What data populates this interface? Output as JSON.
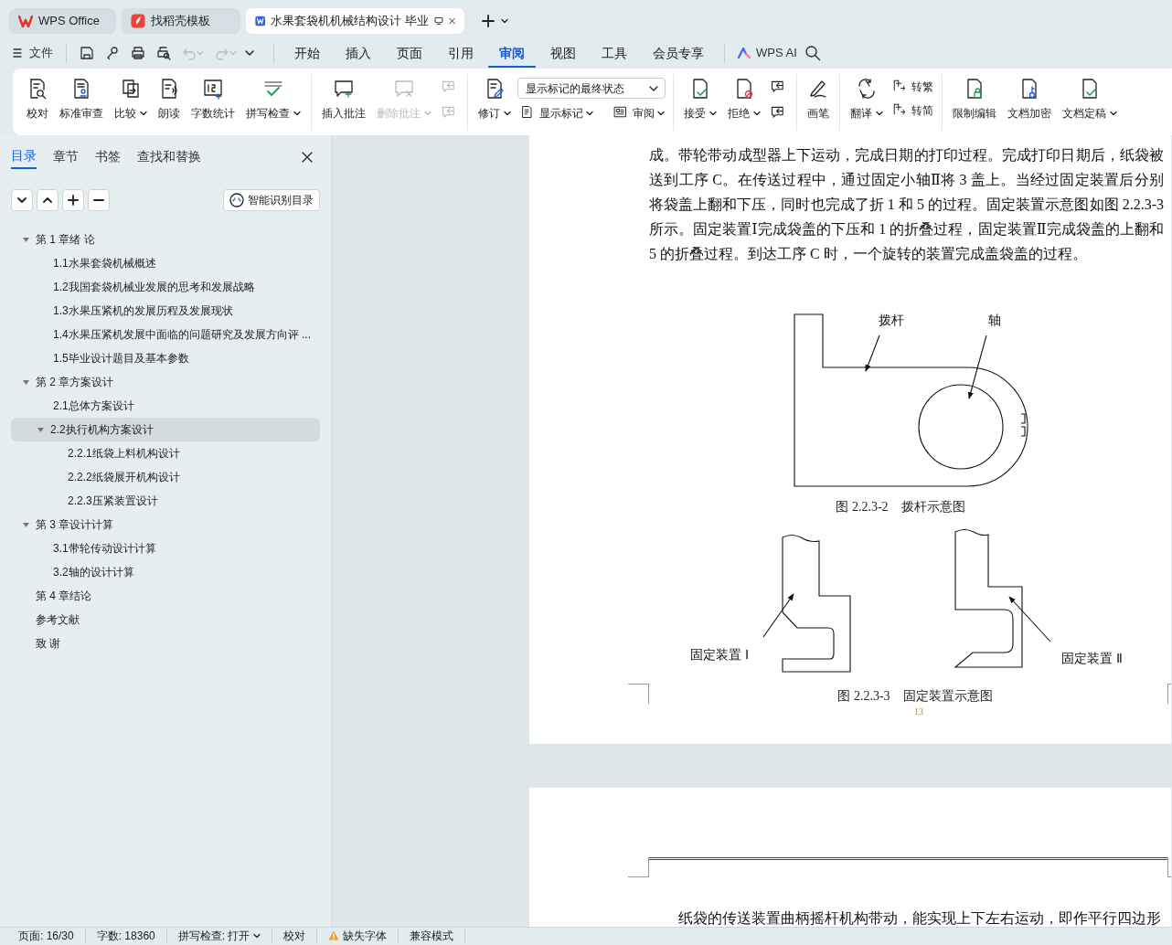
{
  "tabs": [
    {
      "label": "WPS Office",
      "kind": "home",
      "selected": false
    },
    {
      "label": "找稻壳模板",
      "kind": "template",
      "selected": false
    },
    {
      "label": "水果套袋机机械结构设计 毕业",
      "kind": "document",
      "selected": true
    }
  ],
  "menu": {
    "file": "文件",
    "tabs": [
      {
        "label": "开始",
        "selected": false
      },
      {
        "label": "插入",
        "selected": false
      },
      {
        "label": "页面",
        "selected": false
      },
      {
        "label": "引用",
        "selected": false
      },
      {
        "label": "审阅",
        "selected": true
      },
      {
        "label": "视图",
        "selected": false
      },
      {
        "label": "工具",
        "selected": false
      },
      {
        "label": "会员专享",
        "selected": false
      }
    ],
    "ai": "WPS AI"
  },
  "ribbon": [
    {
      "items": [
        {
          "kind": "large",
          "label": "校对",
          "dropdown": false,
          "disabled": false
        },
        {
          "kind": "large",
          "label": "标准审查",
          "dropdown": false,
          "disabled": false
        },
        {
          "kind": "large",
          "label": "比较",
          "dropdown": true,
          "disabled": false
        },
        {
          "kind": "large",
          "label": "朗读",
          "dropdown": false,
          "disabled": false
        },
        {
          "kind": "large",
          "label": "字数统计",
          "dropdown": false,
          "disabled": false
        },
        {
          "kind": "large",
          "label": "拼写检查",
          "dropdown": true,
          "disabled": false
        }
      ]
    },
    {
      "items": [
        {
          "kind": "large",
          "label": "插入批注",
          "dropdown": false,
          "disabled": false
        },
        {
          "kind": "large",
          "label": "删除批注",
          "dropdown": true,
          "disabled": true
        },
        {
          "kind": "column",
          "rows": [
            [
              {
                "kind": "small",
                "dropdown": false,
                "disabled": true
              }
            ],
            [
              {
                "kind": "small",
                "dropdown": false,
                "disabled": true
              }
            ]
          ]
        }
      ]
    },
    {
      "items": [
        {
          "kind": "large",
          "label": "修订",
          "dropdown": true,
          "disabled": false
        },
        {
          "kind": "column",
          "rows": [
            [
              {
                "kind": "select",
                "value": "显示标记的最终状态"
              }
            ],
            [
              {
                "kind": "small",
                "label": "显示标记",
                "dropdown": true,
                "disabled": false
              },
              {
                "kind": "small",
                "label": "审阅",
                "dropdown": true,
                "disabled": false
              }
            ]
          ]
        }
      ]
    },
    {
      "items": [
        {
          "kind": "large",
          "label": "接受",
          "dropdown": true,
          "disabled": false
        },
        {
          "kind": "large",
          "label": "拒绝",
          "dropdown": true,
          "disabled": false
        },
        {
          "kind": "column",
          "rows": [
            [
              {
                "kind": "small",
                "dropdown": false,
                "disabled": false
              }
            ],
            [
              {
                "kind": "small",
                "dropdown": false,
                "disabled": false
              }
            ]
          ]
        }
      ]
    },
    {
      "items": [
        {
          "kind": "large",
          "label": "画笔",
          "dropdown": false,
          "disabled": false
        }
      ]
    },
    {
      "items": [
        {
          "kind": "large",
          "label": "翻译",
          "dropdown": true,
          "disabled": false
        },
        {
          "kind": "column",
          "rows": [
            [
              {
                "kind": "small",
                "label": "转繁",
                "dropdown": false,
                "disabled": false
              }
            ],
            [
              {
                "kind": "small",
                "label": "转简",
                "dropdown": false,
                "disabled": false
              }
            ]
          ]
        }
      ]
    },
    {
      "items": [
        {
          "kind": "large",
          "label": "限制编辑",
          "dropdown": false,
          "disabled": false
        },
        {
          "kind": "large",
          "label": "文档加密",
          "dropdown": false,
          "disabled": false
        },
        {
          "kind": "large",
          "label": "文档定稿",
          "dropdown": true,
          "disabled": false
        }
      ]
    }
  ],
  "sidebar": {
    "tabs": [
      {
        "label": "目录",
        "selected": true
      },
      {
        "label": "章节",
        "selected": false
      },
      {
        "label": "书签",
        "selected": false
      },
      {
        "label": "查找和替换",
        "selected": false
      }
    ],
    "smart_button": "智能识别目录",
    "outline": [
      {
        "label": "第 1 章绪  论",
        "selected": false,
        "expanded": true,
        "children": [
          {
            "label": "1.1水果套袋机械概述",
            "selected": false
          },
          {
            "label": "1.2我国套袋机械业发展的思考和发展战略",
            "selected": false
          },
          {
            "label": "1.3水果压紧机的发展历程及发展现状",
            "selected": false
          },
          {
            "label": "1.4水果压紧机发展中面临的问题研究及发展方向评 ...",
            "selected": false
          },
          {
            "label": "1.5毕业设计题目及基本参数",
            "selected": false
          }
        ]
      },
      {
        "label": "第 2 章方案设计",
        "selected": false,
        "expanded": true,
        "children": [
          {
            "label": "2.1总体方案设计",
            "selected": false
          },
          {
            "label": "2.2执行机构方案设计",
            "selected": true,
            "expanded": true,
            "children": [
              {
                "label": "2.2.1纸袋上料机构设计",
                "selected": false
              },
              {
                "label": "2.2.2纸袋展开机构设计",
                "selected": false
              },
              {
                "label": "2.2.3压紧装置设计",
                "selected": false
              }
            ]
          }
        ]
      },
      {
        "label": "第 3 章设计计算",
        "selected": false,
        "expanded": true,
        "children": [
          {
            "label": "3.1带轮传动设计计算",
            "selected": false
          },
          {
            "label": "3.2轴的设计计算",
            "selected": false
          }
        ]
      },
      {
        "label": "第 4 章结论",
        "selected": false
      },
      {
        "label": "参考文献",
        "selected": false
      },
      {
        "label": "致  谢",
        "selected": false
      }
    ]
  },
  "page_1": {
    "paragraph": "成。带轮带动成型器上下运动，完成日期的打印过程。完成打印日期后，纸袋被送到工序 C。在传送过程中，通过固定小轴Ⅱ将 3 盖上。当经过固定装置后分别将袋盖上翻和下压，同时也完成了折 1 和 5 的过程。固定装置示意图如图 2.2.3-3 所示。固定装置Ⅰ完成袋盖的下压和 1 的折叠过程，固定装置Ⅱ完成袋盖的上翻和 5 的折叠过程。到达工序 C 时，一个旋转的装置完成盖袋盖的过程。",
    "figure_1": {
      "labels": [
        "拨杆",
        "轴"
      ],
      "caption": "图 2.2.3-2　拨杆示意图"
    },
    "figure_2": {
      "labels": [
        "固定装置 Ⅰ",
        "固定装置 Ⅱ"
      ],
      "caption": "图 2.2.3-3　固定装置示意图"
    },
    "page_number": "13"
  },
  "page_2": {
    "paragraph": "纸袋的传送装置曲柄摇杆机构带动，能实现上下左右运动，即作平行四边形"
  },
  "status_bar": [
    {
      "label": "页面: 16/30",
      "dropdown": false,
      "warning": false
    },
    {
      "label": "字数: 18360",
      "dropdown": false,
      "warning": false
    },
    {
      "label": "拼写检查: 打开",
      "dropdown": true,
      "warning": false
    },
    {
      "label": "校对",
      "dropdown": false,
      "warning": false
    },
    {
      "label": "缺失字体",
      "dropdown": false,
      "warning": true
    },
    {
      "label": "兼容模式",
      "dropdown": false,
      "warning": false
    }
  ]
}
